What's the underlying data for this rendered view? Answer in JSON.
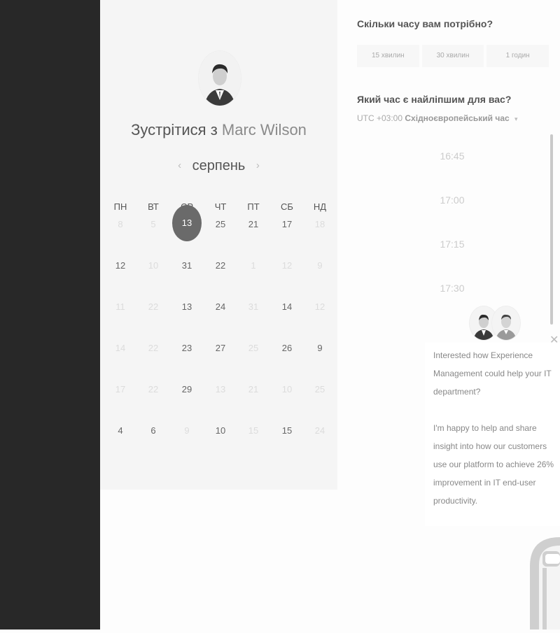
{
  "booking": {
    "title_prefix": "Зустрітися з",
    "host_name": "Marc Wilson",
    "month": "серпень",
    "prev_icon": "chevron-left-icon",
    "next_icon": "chevron-right-icon",
    "weekdays": [
      "ПН",
      "ВТ",
      "СР",
      "ЧТ",
      "ПТ",
      "СБ",
      "НД"
    ],
    "weeks": [
      [
        {
          "d": "8",
          "m": true
        },
        {
          "d": "5",
          "m": true
        },
        {
          "d": "13",
          "sel": true
        },
        {
          "d": "25"
        },
        {
          "d": "21"
        },
        {
          "d": "17"
        },
        {
          "d": "18",
          "m": true
        }
      ],
      [
        {
          "d": "12"
        },
        {
          "d": "10",
          "m": true
        },
        {
          "d": "31"
        },
        {
          "d": "22"
        },
        {
          "d": "1",
          "m": true
        },
        {
          "d": "12",
          "m": true
        },
        {
          "d": "9",
          "m": true
        }
      ],
      [
        {
          "d": "11",
          "m": true
        },
        {
          "d": "22",
          "m": true
        },
        {
          "d": "13"
        },
        {
          "d": "24"
        },
        {
          "d": "31",
          "m": true
        },
        {
          "d": "14"
        },
        {
          "d": "12",
          "m": true
        }
      ],
      [
        {
          "d": "14",
          "m": true
        },
        {
          "d": "22",
          "m": true
        },
        {
          "d": "23"
        },
        {
          "d": "27"
        },
        {
          "d": "25",
          "m": true
        },
        {
          "d": "26"
        },
        {
          "d": "9"
        }
      ],
      [
        {
          "d": "17",
          "m": true
        },
        {
          "d": "22",
          "m": true
        },
        {
          "d": "29"
        },
        {
          "d": "13",
          "m": true
        },
        {
          "d": "21",
          "m": true
        },
        {
          "d": "10",
          "m": true
        },
        {
          "d": "25",
          "m": true
        }
      ],
      [
        {
          "d": "4"
        },
        {
          "d": "6"
        },
        {
          "d": "9",
          "m": true
        },
        {
          "d": "10"
        },
        {
          "d": "15",
          "m": true
        },
        {
          "d": "15"
        },
        {
          "d": "24",
          "m": true
        }
      ]
    ]
  },
  "schedule": {
    "duration_question": "Скільки часу вам потрібно?",
    "durations": [
      "15 хвилин",
      "30 хвилин",
      "1 годин"
    ],
    "time_question": "Який час є найліпшим для вас?",
    "timezone_offset": "UTC +03:00",
    "timezone_name": "Східноєвропейський час",
    "timezone_caret": "▾",
    "time_slots": [
      "16:45",
      "17:00",
      "17:15",
      "17:30"
    ]
  },
  "chat": {
    "close_icon": "close-icon",
    "paragraph1": "Interested how Experience Management could help your IT department?",
    "paragraph2": "I'm happy to help and share insight into how our customers use our platform to achieve 26% improvement in IT end-user productivity."
  }
}
